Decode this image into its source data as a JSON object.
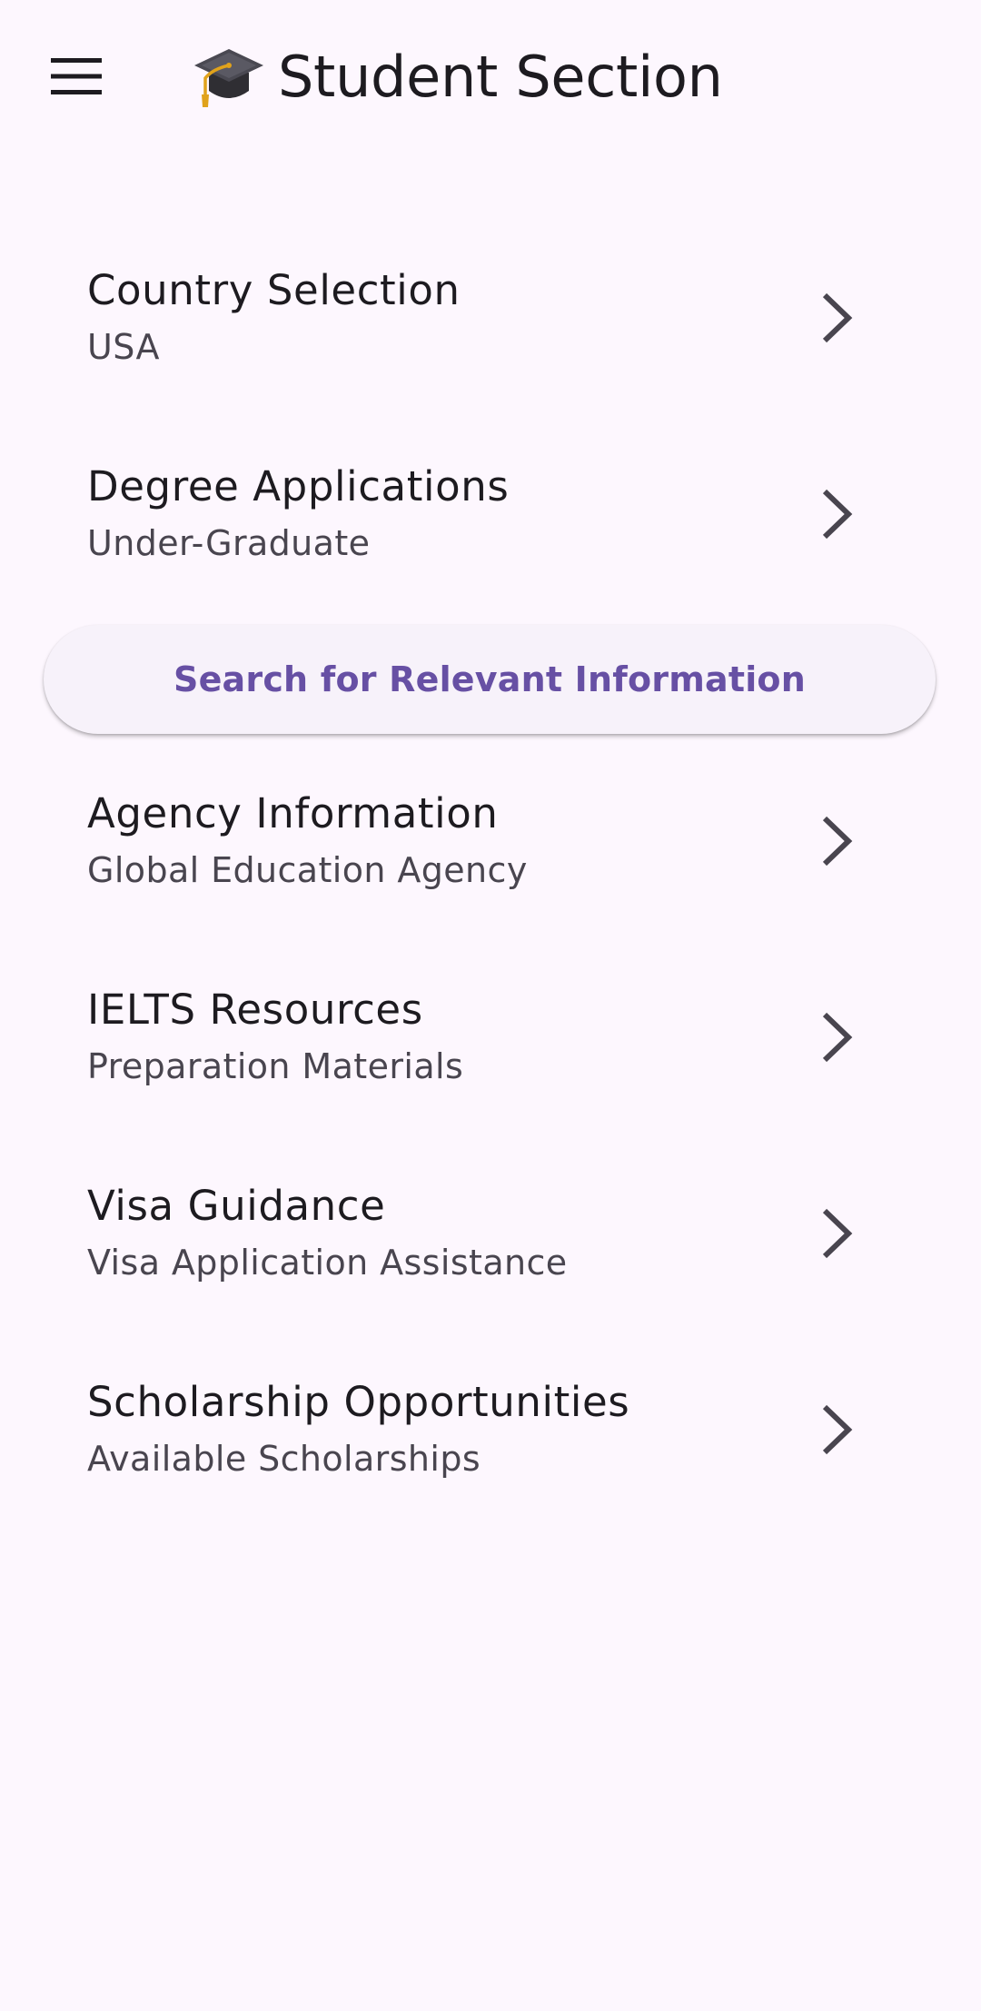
{
  "header": {
    "title": "Student Section",
    "menu_icon": "hamburger-menu-icon",
    "title_icon": "graduation-cap-icon"
  },
  "list": {
    "country": {
      "title": "Country Selection",
      "subtitle": "USA"
    },
    "degree": {
      "title": "Degree Applications",
      "subtitle": "Under-Graduate"
    },
    "agency": {
      "title": "Agency Information",
      "subtitle": "Global Education Agency"
    },
    "ielts": {
      "title": "IELTS Resources",
      "subtitle": "Preparation Materials"
    },
    "visa": {
      "title": "Visa Guidance",
      "subtitle": "Visa Application Assistance"
    },
    "scholarship": {
      "title": "Scholarship Opportunities",
      "subtitle": "Available Scholarships"
    }
  },
  "search_button": {
    "label": "Search for Relevant Information"
  },
  "colors": {
    "background": "#fdf7fe",
    "primary": "#6750a4",
    "on_surface": "#1d1b20",
    "on_surface_variant": "#49454f",
    "button_surface": "#f7f2fa"
  }
}
